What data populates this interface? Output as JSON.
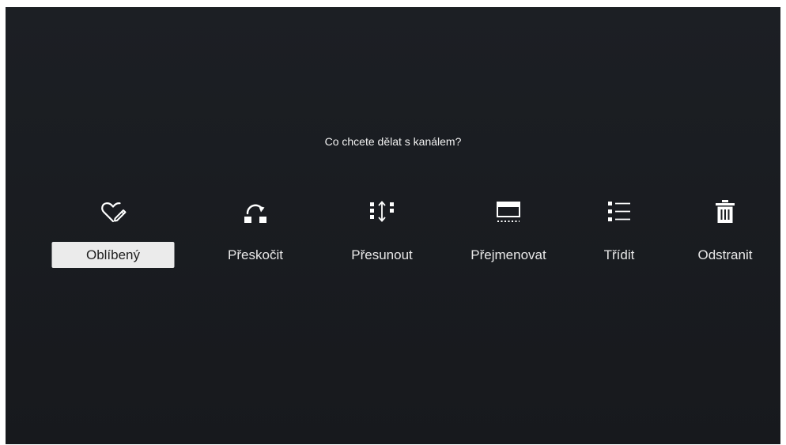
{
  "dialog": {
    "prompt": "Co chcete dělat s kanálem?"
  },
  "actions": [
    {
      "label": "Oblíbený",
      "icon": "heart-edit-icon",
      "selected": true
    },
    {
      "label": "Přeskočit",
      "icon": "skip-icon",
      "selected": false
    },
    {
      "label": "Přesunout",
      "icon": "move-icon",
      "selected": false
    },
    {
      "label": "Přejmenovat",
      "icon": "rename-icon",
      "selected": false
    },
    {
      "label": "Třídit",
      "icon": "sort-list-icon",
      "selected": false
    },
    {
      "label": "Odstranit",
      "icon": "trash-icon",
      "selected": false
    }
  ],
  "colors": {
    "background": "#1b1e22",
    "text": "#e8e8e8",
    "selected_background": "#ebebeb",
    "selected_text": "#1f1f1f"
  }
}
